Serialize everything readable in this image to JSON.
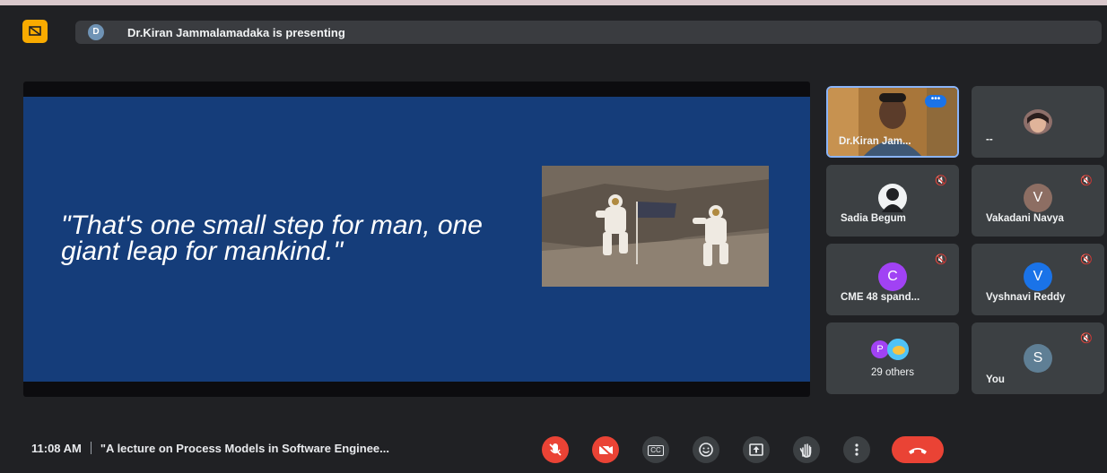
{
  "presenting": {
    "avatar_letter": "D",
    "text": "Dr.Kiran Jammalamadaka is presenting"
  },
  "slide": {
    "quote": "\"That's one small step for man, one giant leap for mankind.\""
  },
  "participants": [
    {
      "name": "Dr.Kiran Jam...",
      "type": "video"
    },
    {
      "name": "--",
      "type": "photo"
    },
    {
      "name": "Sadia Begum",
      "type": "silhouette",
      "muted": true
    },
    {
      "name": "Vakadani Navya",
      "letter": "V",
      "color": "#8d6e63",
      "muted": true
    },
    {
      "name": "CME 48 spand...",
      "letter": "C",
      "color": "#a142f4",
      "muted": true
    },
    {
      "name": "Vyshnavi Reddy",
      "letter": "V",
      "color": "#1a73e8",
      "muted": true
    },
    {
      "name": "29 others",
      "letter": "P",
      "color": "#a142f4"
    },
    {
      "name": "You",
      "letter": "S",
      "color": "#5f7f95",
      "muted": true
    }
  ],
  "bottom_bar": {
    "time": "11:08 AM",
    "meeting_title": "\"A lecture on Process Models in Software Enginee..."
  },
  "controls": {
    "captions_label": "CC"
  },
  "colors": {
    "background": "#202124",
    "tile": "#3c4043",
    "slide": "#153d7a",
    "accent_red": "#ea4335",
    "presenting_icon": "#f9ab00",
    "active_speaker_border": "#8ab4f8"
  }
}
